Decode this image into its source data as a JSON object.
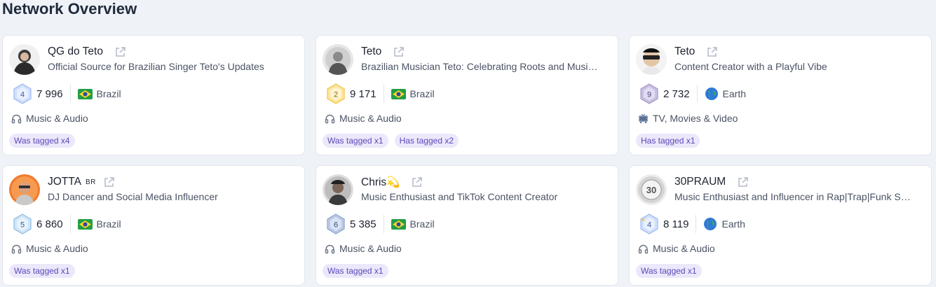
{
  "page": {
    "title": "Network Overview"
  },
  "colors": {
    "background": "#eff2f7",
    "tag_bg": "#ece8fb",
    "tag_text": "#5c48b9"
  },
  "cards": [
    {
      "name": "QG do Teto",
      "name_suffix": "",
      "description": "Official Source for Brazilian Singer Teto's Updates",
      "badge_level": "4",
      "followers": "7 996",
      "country": "Brazil",
      "country_icon": "flag-brazil-icon",
      "category": "Music & Audio",
      "category_icon": "headphones-icon",
      "tags": [
        "Was tagged x4"
      ]
    },
    {
      "name": "Teto",
      "name_suffix": "",
      "description": "Brazilian Musician Teto: Celebrating Roots and Musi…",
      "badge_level": "2",
      "followers": "9 171",
      "country": "Brazil",
      "country_icon": "flag-brazil-icon",
      "category": "Music & Audio",
      "category_icon": "headphones-icon",
      "tags": [
        "Was tagged x1",
        "Has tagged x2"
      ]
    },
    {
      "name": "Teto",
      "name_suffix": "",
      "description": "Content Creator with a Playful Vibe",
      "badge_level": "9",
      "followers": "2 732",
      "country": "Earth",
      "country_icon": "globe-icon",
      "category": "TV, Movies & Video",
      "category_icon": "tv-icon",
      "tags": [
        "Has tagged x1"
      ]
    },
    {
      "name": "JOTTA",
      "name_suffix": "BR",
      "description": "DJ Dancer and Social Media Influencer",
      "badge_level": "5",
      "followers": "6 860",
      "country": "Brazil",
      "country_icon": "flag-brazil-icon",
      "category": "Music & Audio",
      "category_icon": "headphones-icon",
      "tags": [
        "Was tagged x1"
      ]
    },
    {
      "name": "Chris💫",
      "name_suffix": "",
      "description": "Music Enthusiast and TikTok Content Creator",
      "badge_level": "6",
      "followers": "5 385",
      "country": "Brazil",
      "country_icon": "flag-brazil-icon",
      "category": "Music & Audio",
      "category_icon": "headphones-icon",
      "tags": [
        "Was tagged x1"
      ]
    },
    {
      "name": "30PRAUM",
      "name_suffix": "",
      "description": "Music Enthusiast and Influencer in Rap|Trap|Funk S…",
      "badge_level": "4",
      "followers": "8 119",
      "country": "Earth",
      "country_icon": "globe-icon",
      "category": "Music & Audio",
      "category_icon": "headphones-icon",
      "tags": [
        "Was tagged x1"
      ]
    }
  ]
}
